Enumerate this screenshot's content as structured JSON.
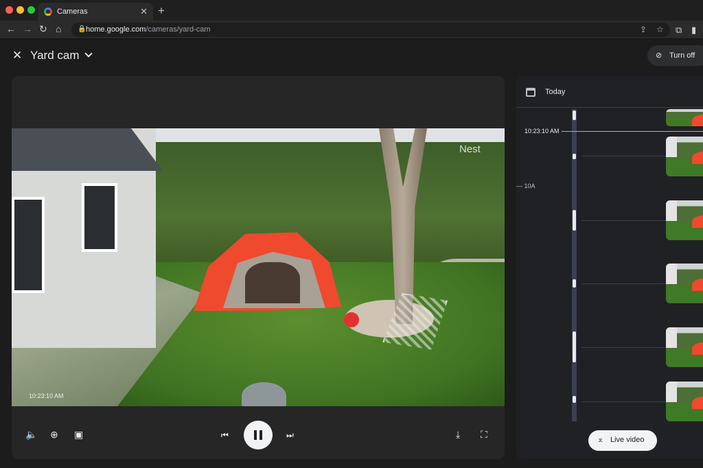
{
  "browser": {
    "tab_title": "Cameras",
    "close_glyph": "✕",
    "new_tab_glyph": "+",
    "url_host": "home.google.com",
    "url_path": "/cameras/yard-cam",
    "nav_icons": {
      "back": "←",
      "forward": "→",
      "reload": "↻",
      "home": "⌂"
    },
    "window_controls_colors": [
      "#ff5f57",
      "#febc2e",
      "#28c840"
    ]
  },
  "header": {
    "close_glyph": "✕",
    "camera_name": "Yard cam",
    "turn_off_label": "Turn off",
    "turn_off_icon": "video-off-icon"
  },
  "player": {
    "watermark": "Nest",
    "timestamp": "10:23:10 AM",
    "controls": [
      "volume-icon",
      "zoom-icon",
      "picture-in-picture-icon",
      "previous-icon",
      "pause-icon",
      "next-icon",
      "download-icon",
      "fullscreen-icon"
    ]
  },
  "timeline": {
    "date_label": "Today",
    "current_time": "10:23:10 AM",
    "hour_tick": "10A",
    "thumbnail_count": 6,
    "accent_color": "#8ab4f8"
  },
  "live_button": {
    "label": "Live video",
    "icon": "jump-to-live-icon"
  }
}
